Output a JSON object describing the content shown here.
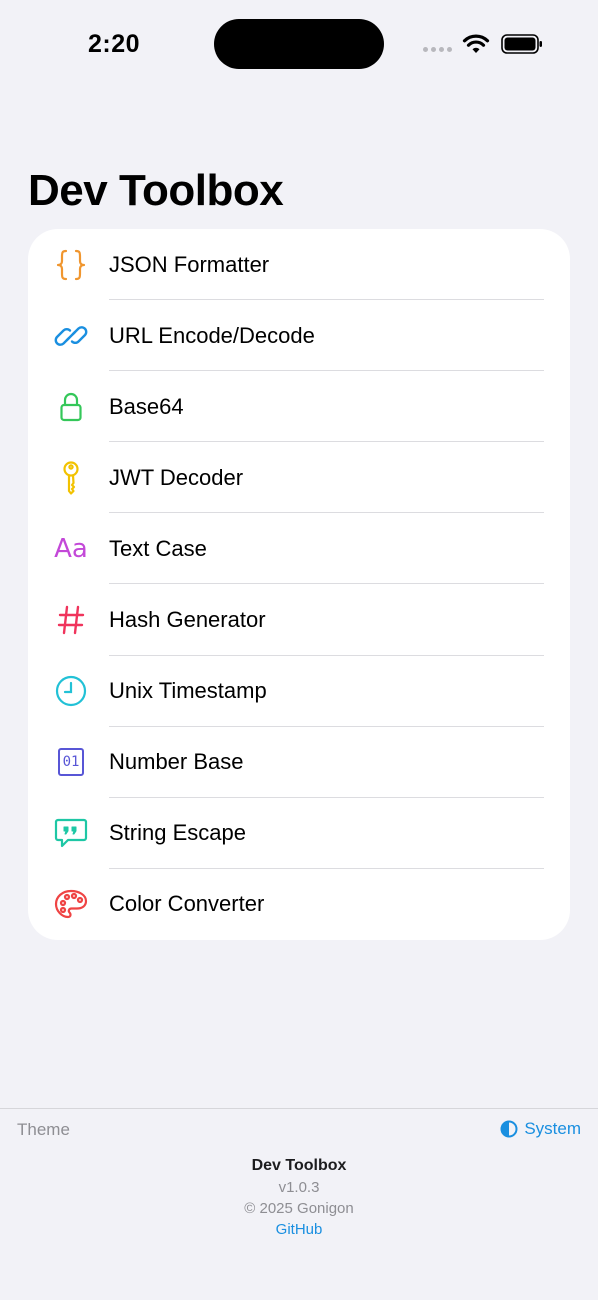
{
  "status_bar": {
    "time": "2:20"
  },
  "page": {
    "title": "Dev Toolbox"
  },
  "tools": [
    {
      "label": "JSON Formatter",
      "icon": "curly-braces-icon",
      "color": "#f0962f"
    },
    {
      "label": "URL Encode/Decode",
      "icon": "link-icon",
      "color": "#1a8fe0"
    },
    {
      "label": "Base64",
      "icon": "lock-icon",
      "color": "#34c759"
    },
    {
      "label": "JWT Decoder",
      "icon": "key-icon",
      "color": "#f2c200"
    },
    {
      "label": "Text Case",
      "icon": "text-case-icon",
      "color": "#c348d8",
      "glyph": "Aa"
    },
    {
      "label": "Hash Generator",
      "icon": "hash-icon",
      "color": "#f0345c",
      "glyph": "#"
    },
    {
      "label": "Unix Timestamp",
      "icon": "clock-icon",
      "color": "#22c1d6"
    },
    {
      "label": "Number Base",
      "icon": "binary-icon",
      "color": "#5856d6",
      "glyph": "01"
    },
    {
      "label": "String Escape",
      "icon": "quote-bubble-icon",
      "color": "#1ec7a5"
    },
    {
      "label": "Color Converter",
      "icon": "palette-icon",
      "color": "#ef4444"
    }
  ],
  "footer": {
    "theme_label": "Theme",
    "theme_value": "System",
    "app_name": "Dev Toolbox",
    "version": "v1.0.3",
    "copyright": "© 2025 Gonigon",
    "github_link": "GitHub",
    "accent_color": "#1a8fe0"
  }
}
